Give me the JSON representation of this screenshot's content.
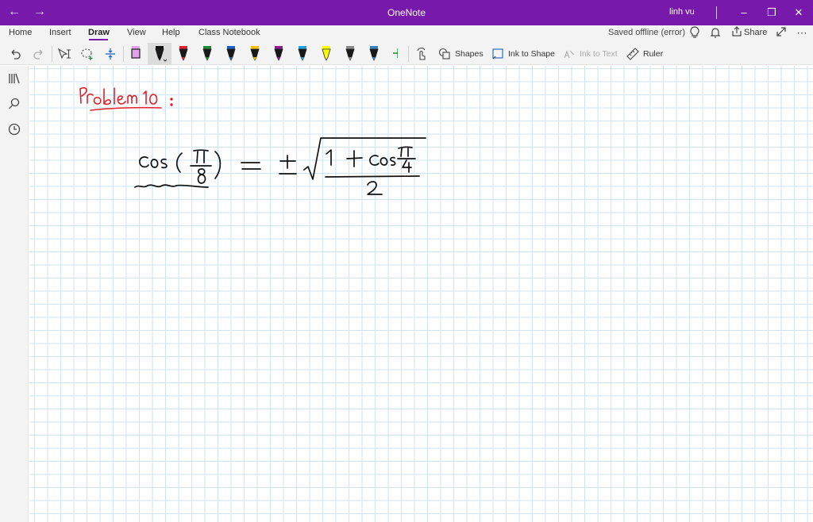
{
  "titlebar": {
    "app_title": "OneNote",
    "user_name": "linh vu",
    "back_icon": "back-arrow-icon",
    "forward_icon": "forward-arrow-icon"
  },
  "tabs": [
    "Home",
    "Insert",
    "Draw",
    "View",
    "Help",
    "Class Notebook"
  ],
  "active_tab": "Draw",
  "status": "Saved offline (error)",
  "share_label": "Share",
  "toolbar": {
    "shapes_label": "Shapes",
    "ink_to_shape_label": "Ink to Shape",
    "ink_to_text_label": "Ink to Text",
    "ruler_label": "Ruler"
  },
  "pens": [
    {
      "name": "pink-highlighter",
      "color": "#e0a2e8"
    },
    {
      "name": "black-pen",
      "color": "#111111"
    },
    {
      "name": "red-pen",
      "color": "#e0202a"
    },
    {
      "name": "green-pen",
      "color": "#1f8a3a"
    },
    {
      "name": "blue-pen",
      "color": "#1e5fbf"
    },
    {
      "name": "yellow-pen",
      "color": "#f2c200"
    },
    {
      "name": "purple-pen",
      "color": "#8b1e8b"
    },
    {
      "name": "cyan-pen",
      "color": "#1fa3d8"
    },
    {
      "name": "yellow-highlighter",
      "color": "#ffff00"
    },
    {
      "name": "gray-pen",
      "color": "#8a8a8a"
    },
    {
      "name": "blue-gray-pen",
      "color": "#3a7fc2"
    }
  ],
  "colors": {
    "accent": "#7719aa",
    "ink_red": "#e0202a",
    "ink_black": "#111111",
    "grid": "#cfe6f2"
  }
}
